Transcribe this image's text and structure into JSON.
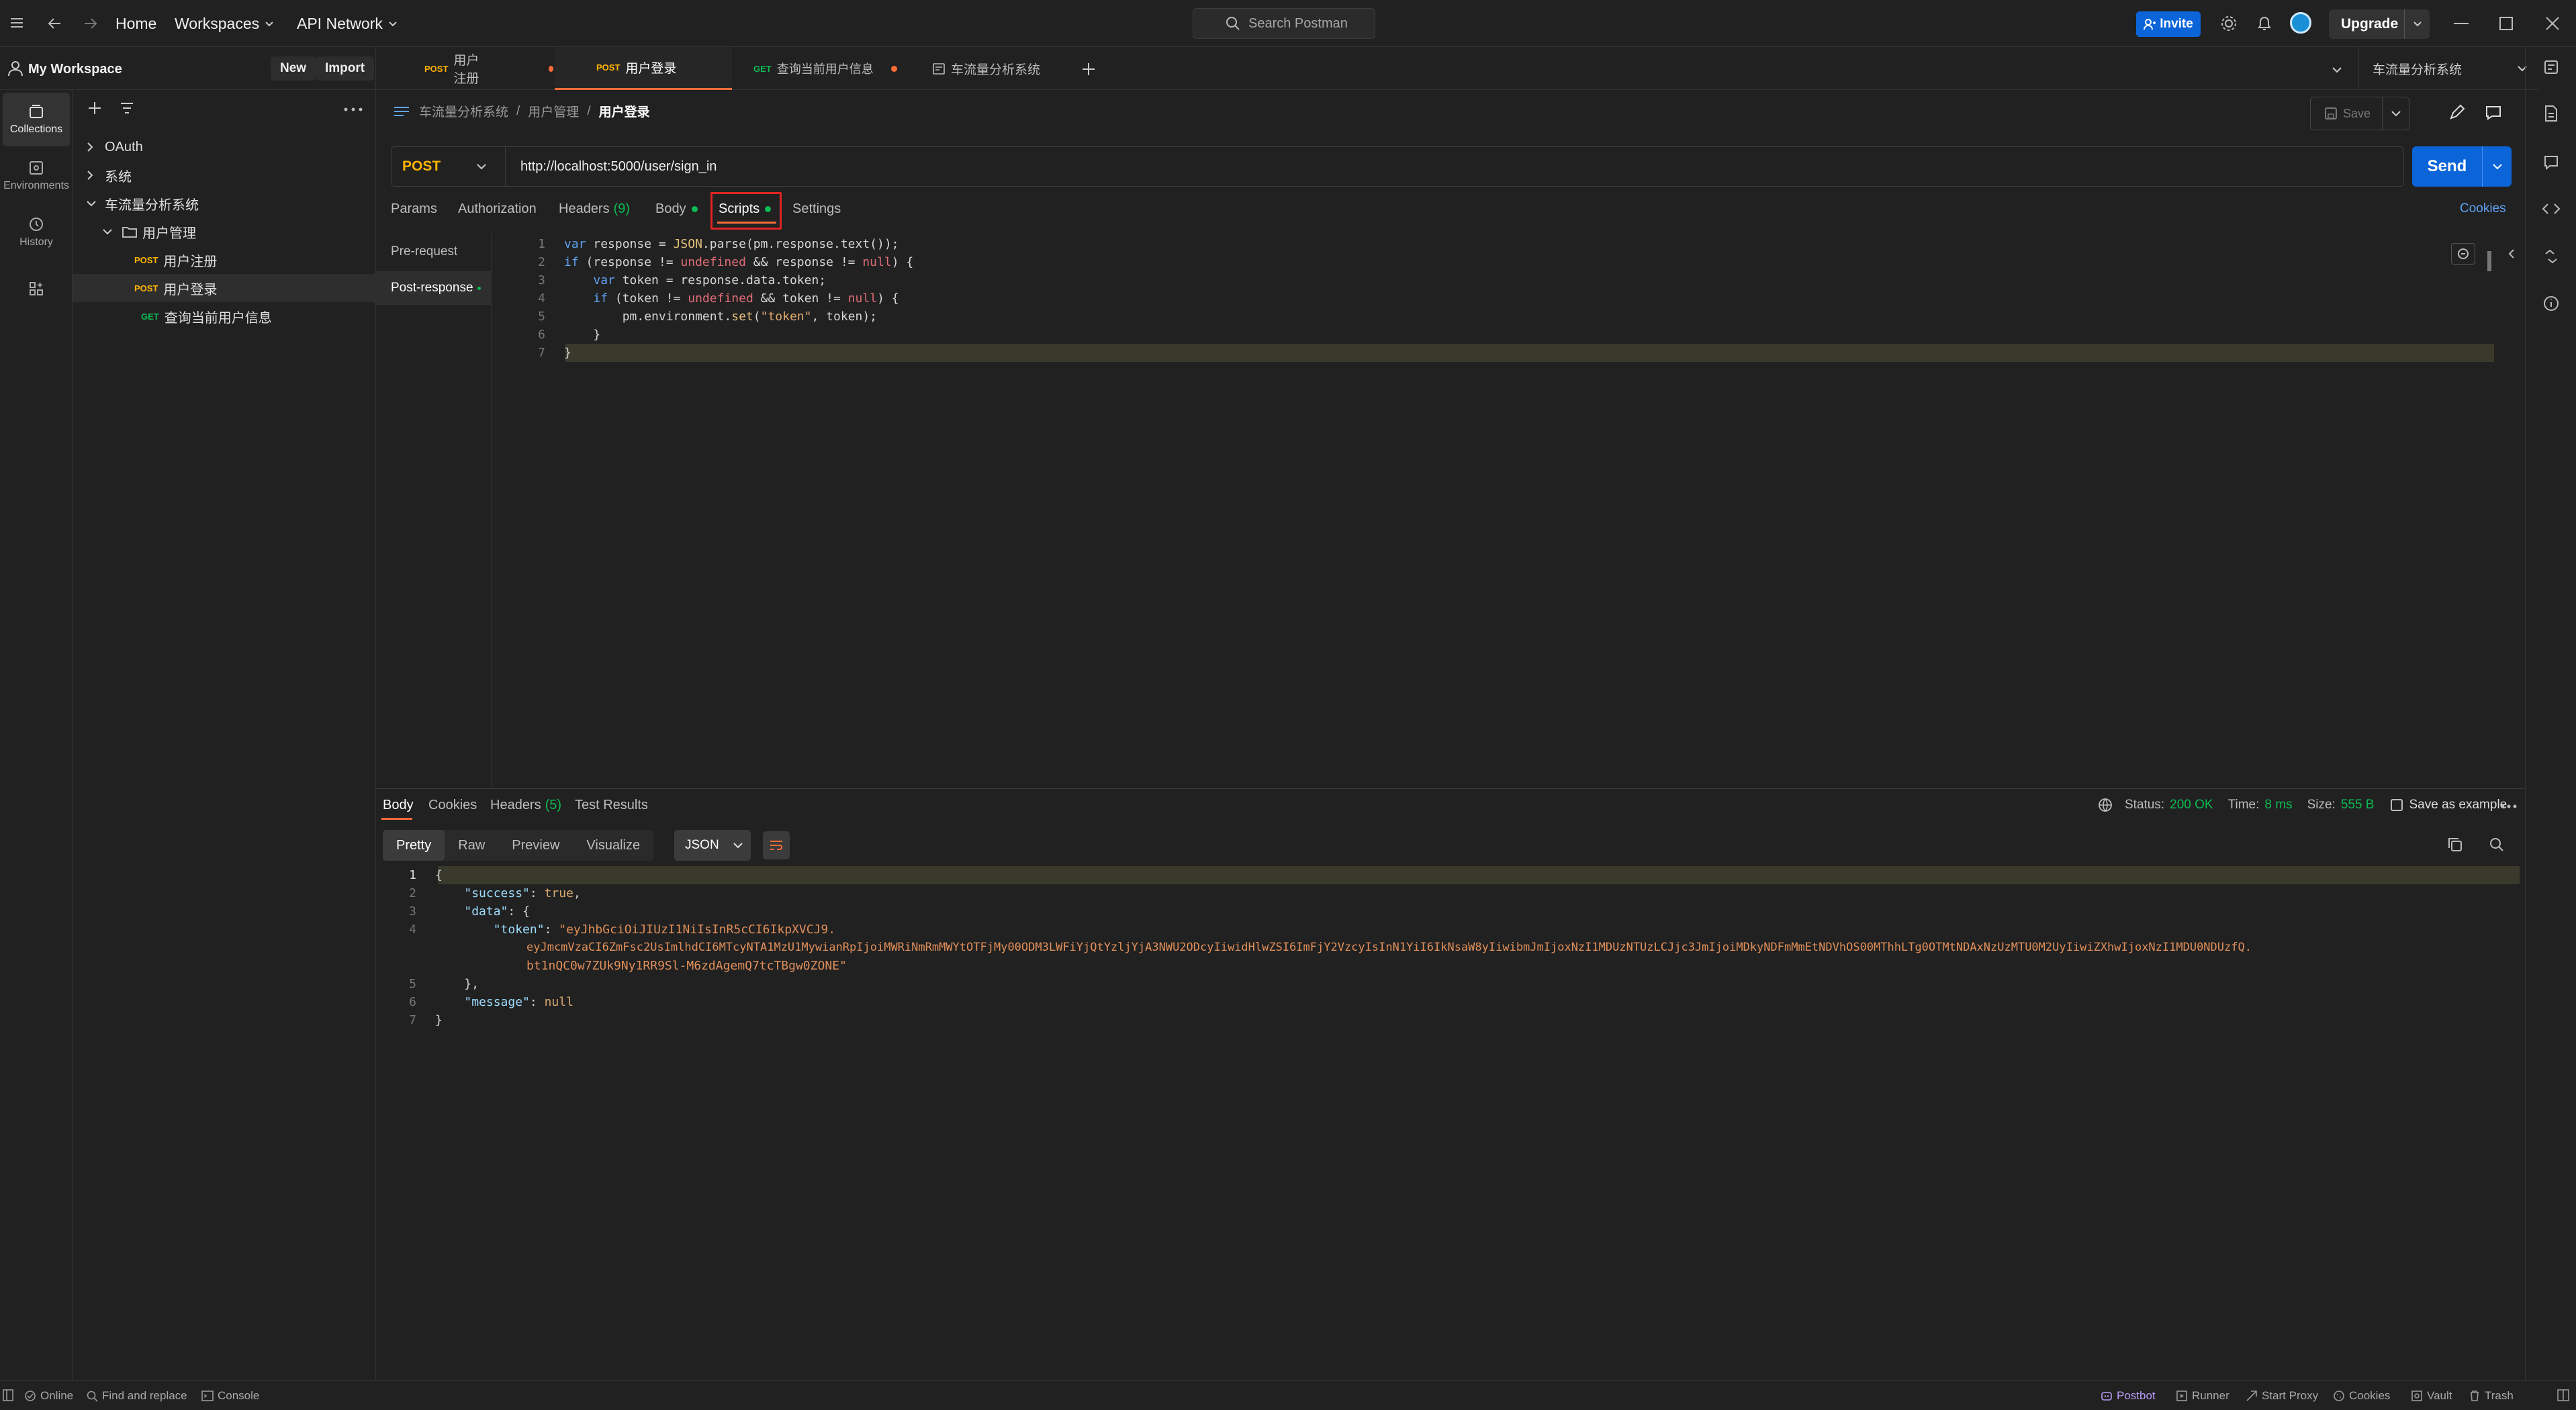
{
  "titlebar": {
    "home": "Home",
    "workspaces": "Workspaces",
    "api_network": "API Network",
    "search_placeholder": "Search Postman",
    "invite": "Invite",
    "upgrade": "Upgrade"
  },
  "workspace": {
    "name": "My Workspace",
    "new": "New",
    "import": "Import"
  },
  "rail": [
    {
      "label": "Collections",
      "icon": "collections-icon"
    },
    {
      "label": "Environments",
      "icon": "environments-icon"
    },
    {
      "label": "History",
      "icon": "history-icon"
    }
  ],
  "sidebar": {
    "items": [
      {
        "label": "OAuth"
      },
      {
        "label": "系统"
      },
      {
        "label": "车流量分析系统"
      },
      {
        "label": "用户管理"
      },
      {
        "method": "POST",
        "label": "用户注册"
      },
      {
        "method": "POST",
        "label": "用户登录"
      },
      {
        "method": "GET",
        "label": "查询当前用户信息"
      }
    ]
  },
  "tabs": [
    {
      "method": "POST",
      "label": "用户注册"
    },
    {
      "method": "POST",
      "label": "用户登录"
    },
    {
      "method": "GET",
      "label": "查询当前用户信息"
    },
    {
      "label": "车流量分析系统"
    }
  ],
  "environment": "车流量分析系统",
  "breadcrumb": {
    "root": "车流量分析系统",
    "sep1": "/",
    "folder": "用户管理",
    "sep2": "/",
    "current": "用户登录"
  },
  "save_label": "Save",
  "request": {
    "method": "POST",
    "url": "http://localhost:5000/user/sign_in",
    "send": "Send"
  },
  "req_tabs": {
    "params": "Params",
    "authorization": "Authorization",
    "headers": "Headers",
    "headers_count": "(9)",
    "body": "Body",
    "scripts": "Scripts",
    "settings": "Settings",
    "cookies": "Cookies"
  },
  "script_tabs": {
    "pre": "Pre-request",
    "post": "Post-response"
  },
  "code": {
    "l1": [
      "var",
      " response = ",
      "JSON",
      ".parse(pm.response.text());"
    ],
    "l2": [
      "if",
      " (response != ",
      "undefined",
      " && response != ",
      "null",
      ") {"
    ],
    "l3": [
      "    ",
      "var",
      " token = response.data.token;"
    ],
    "l4": [
      "    ",
      "if",
      " (token != ",
      "undefined",
      " && token != ",
      "null",
      ") {"
    ],
    "l5": [
      "        pm.environment.",
      "set",
      "(",
      "\"token\"",
      ", token);"
    ],
    "l6": "    }",
    "l7": "}"
  },
  "response": {
    "tabs": {
      "body": "Body",
      "cookies": "Cookies",
      "headers": "Headers",
      "headers_count": "(5)",
      "tests": "Test Results"
    },
    "status_label": "Status:",
    "status": "200 OK",
    "time_label": "Time:",
    "time": "8 ms",
    "size_label": "Size:",
    "size": "555 B",
    "save_example": "Save as example",
    "views": [
      "Pretty",
      "Raw",
      "Preview",
      "Visualize"
    ],
    "format": "JSON",
    "json": {
      "l1": "{",
      "l2_key": "\"success\"",
      "l2_val": "true",
      "l3_key": "\"data\"",
      "l4_key": "\"token\"",
      "l4_val": "\"eyJhbGciOiJIUzI1NiIsInR5cCI6IkpXVCJ9.",
      "l4_cont1": "eyJmcmVzaCI6ZmFsc2UsImlhdCI6MTcyNTA1MzU1MywianRpIjoiMWRiNmRmMWYtOTFjMy00ODM3LWFiYjQtYzljYjA3NWU2ODcyIiwidHlwZSI6ImFjY2VzcyIsInN1YiI6IkNsaW8yIiwibmJmIjoxNzI1MDUzNTUzLCJjc3JmIjoiMDkyNDFmMmEtNDVhOS00MThhLTg0OTMtNDAxNzUzMTU0M2UyIiwiZXhwIjoxNzI1MDU0NDUzfQ.",
      "l4_cont2": "bt1nQC0w7ZUk9Ny1RR9Sl-M6zdAgemQ7tcTBgw0ZONE\"",
      "l5": "},",
      "l6_key": "\"message\"",
      "l6_val": "null",
      "l7": "}"
    }
  },
  "statusbar": {
    "online": "Online",
    "find": "Find and replace",
    "console": "Console",
    "postbot": "Postbot",
    "runner": "Runner",
    "proxy": "Start Proxy",
    "cookies": "Cookies",
    "vault": "Vault",
    "trash": "Trash"
  },
  "colors": {
    "accent": "#ff6c37",
    "primary": "#0b65d9",
    "post": "#ffb400",
    "get": "#0cbb52",
    "status_ok": "#0cbb52",
    "highlight_box": "#e02424"
  }
}
